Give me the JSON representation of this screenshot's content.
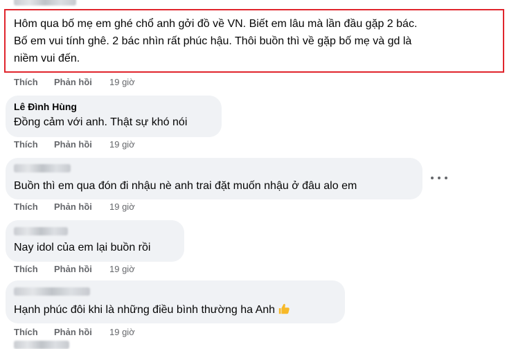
{
  "comments": [
    {
      "author": "",
      "text_lines": [
        "Hôm qua bố mẹ em ghé chổ anh gởi đồ về VN. Biết em lâu mà lần đầu gặp 2 bác.",
        "Bố em vui tính ghê. 2 bác nhìn rất phúc hậu. Thôi buồn thì về gặp bố mẹ và gd là",
        "niềm vui đến."
      ],
      "like": "Thích",
      "reply": "Phản hồi",
      "time": "19 giờ",
      "highlighted": true
    },
    {
      "author": "Lê Đình Hùng",
      "text_lines": [
        "Đồng cảm với anh. Thật sự khó nói"
      ],
      "like": "Thích",
      "reply": "Phản hồi",
      "time": "19 giờ"
    },
    {
      "author": "",
      "text_lines": [
        "Buồn thì em qua đón đi nhậu nè anh trai đặt muốn nhậu ở đâu alo em"
      ],
      "like": "Thích",
      "reply": "Phản hồi",
      "time": "19 giờ"
    },
    {
      "author": "",
      "text_lines": [
        "Nay idol của em lại buồn rồi"
      ],
      "like": "Thích",
      "reply": "Phản hồi",
      "time": "19 giờ"
    },
    {
      "author": "",
      "text_lines": [
        "Hạnh phúc đôi khi là những điều bình thường ha Anh"
      ],
      "like": "Thích",
      "reply": "Phản hồi",
      "time": "19 giờ",
      "emoji": "thumbs-up-icon"
    }
  ],
  "colors": {
    "bubble": "#f0f2f5",
    "highlight": "#e0242c",
    "meta_text": "#65676b",
    "like_emoji": "#f7b928"
  }
}
